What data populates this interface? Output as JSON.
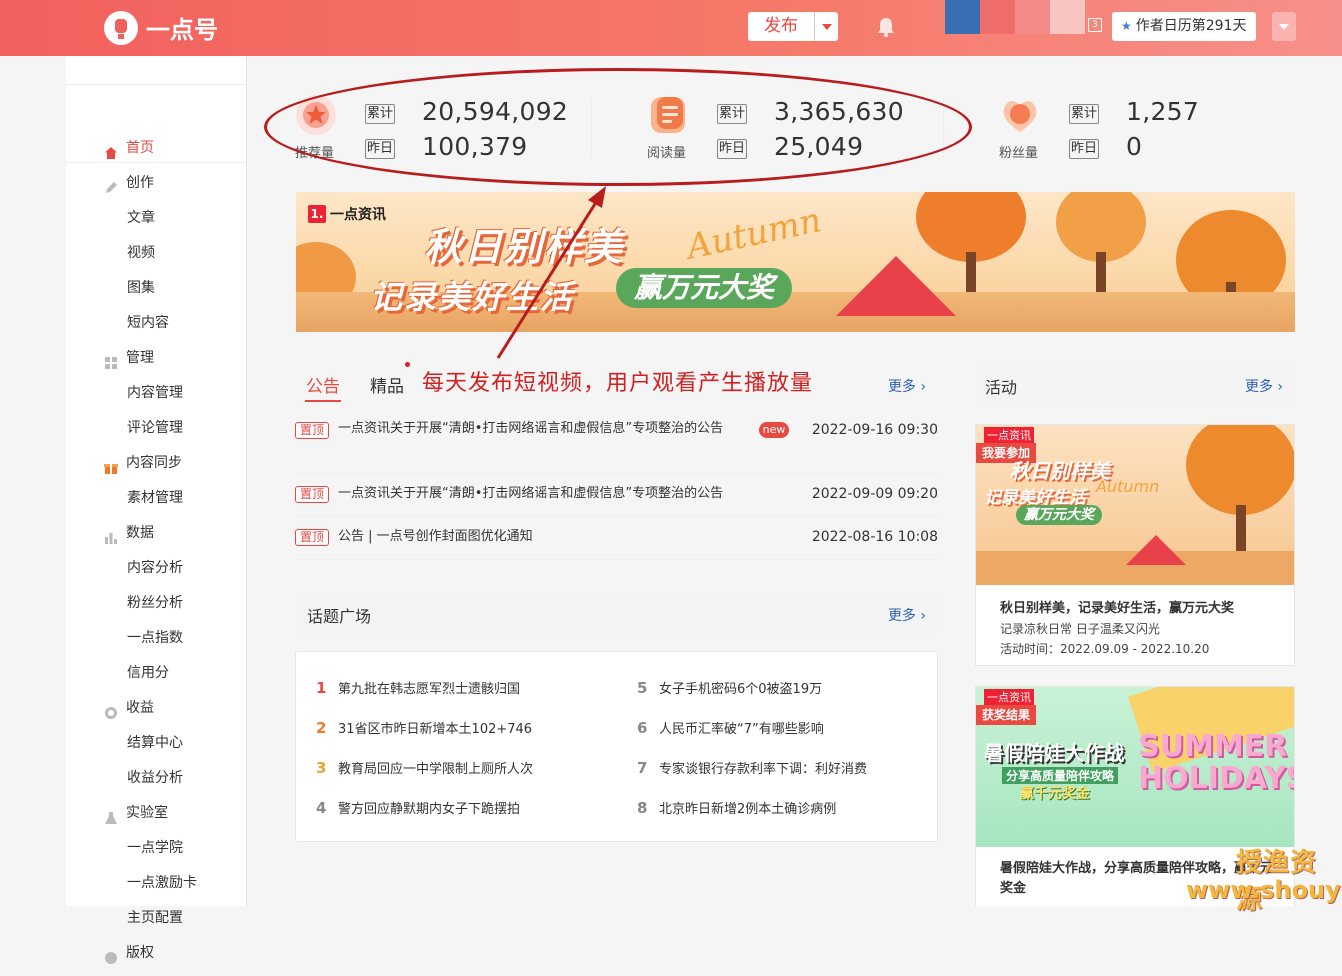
{
  "header": {
    "logo_text": "一点号",
    "publish_label": "发布",
    "notification_count": "3",
    "calendar_label": "作者日历第291天",
    "brand_color": "#f2605d"
  },
  "sidebar": {
    "items": [
      {
        "label": "首页",
        "icon": "home-icon",
        "level": 1,
        "active": true
      },
      {
        "label": "创作",
        "icon": "pen-icon",
        "level": 1
      },
      {
        "label": "文章",
        "level": 2
      },
      {
        "label": "视频",
        "level": 2
      },
      {
        "label": "图集",
        "level": 2
      },
      {
        "label": "短内容",
        "level": 2
      },
      {
        "label": "管理",
        "icon": "grid-icon",
        "level": 1
      },
      {
        "label": "内容管理",
        "level": 2
      },
      {
        "label": "评论管理",
        "level": 2
      },
      {
        "label": "内容同步",
        "icon": "gift-icon",
        "level": 1
      },
      {
        "label": "素材管理",
        "level": 2
      },
      {
        "label": "数据",
        "icon": "bar-chart-icon",
        "level": 1
      },
      {
        "label": "内容分析",
        "level": 2
      },
      {
        "label": "粉丝分析",
        "level": 2
      },
      {
        "label": "一点指数",
        "level": 2
      },
      {
        "label": "信用分",
        "level": 2
      },
      {
        "label": "收益",
        "icon": "coin-icon",
        "level": 1
      },
      {
        "label": "结算中心",
        "level": 2
      },
      {
        "label": "收益分析",
        "level": 2
      },
      {
        "label": "实验室",
        "icon": "flask-icon",
        "level": 1
      },
      {
        "label": "一点学院",
        "level": 2
      },
      {
        "label": "一点激励卡",
        "level": 2
      },
      {
        "label": "主页配置",
        "level": 2
      },
      {
        "label": "版权",
        "icon": "copyright-icon",
        "level": 1
      }
    ]
  },
  "stats": [
    {
      "label": "推荐量",
      "icon": "recommend-icon",
      "total_tag": "累计",
      "total": "20,594,092",
      "yesterday_tag": "昨日",
      "yesterday": "100,379"
    },
    {
      "label": "阅读量",
      "icon": "read-icon",
      "total_tag": "累计",
      "total": "3,365,630",
      "yesterday_tag": "昨日",
      "yesterday": "25,049"
    },
    {
      "label": "粉丝量",
      "icon": "fans-icon",
      "total_tag": "累计",
      "total": "1,257",
      "yesterday_tag": "昨日",
      "yesterday": "0"
    }
  ],
  "banner": {
    "brand": "一点资讯",
    "brand_mark": "1.",
    "title_line1": "秋日别样美",
    "title_line2": "记录美好生活",
    "prize": "赢万元大奖",
    "script_word": "Autumn"
  },
  "annotation": "每天发布短视频，用户观看产生播放量",
  "notice": {
    "tabs": [
      "公告",
      "精品"
    ],
    "more": "更多",
    "pin_label": "置顶",
    "new_label": "new",
    "rows": [
      {
        "text": "一点资讯关于开展“清朗•打击网络谣言和虚假信息”专项整治的公告",
        "date": "2022-09-16 09:30"
      },
      {
        "text": "一点资讯关于开展“清朗•打击网络谣言和虚假信息”专项整治的公告",
        "date": "2022-09-09 09:20"
      },
      {
        "text": "公告 | 一点号创作封面图优化通知",
        "date": "2022-08-16 10:08"
      }
    ]
  },
  "topics": {
    "title": "话题广场",
    "more": "更多",
    "items": [
      {
        "rank": "1",
        "text": "第九批在韩志愿军烈士遗骸归国"
      },
      {
        "rank": "2",
        "text": "31省区市昨日新增本土102+746"
      },
      {
        "rank": "3",
        "text": "教育局回应一中学限制上厕所人次"
      },
      {
        "rank": "4",
        "text": "警方回应静默期内女子下跪摆拍"
      },
      {
        "rank": "5",
        "text": "女子手机密码6个0被盗19万"
      },
      {
        "rank": "6",
        "text": "人民币汇率破“7”有哪些影响"
      },
      {
        "rank": "7",
        "text": "专家谈银行存款利率下调：利好消费"
      },
      {
        "rank": "8",
        "text": "北京昨日新增2例本土确诊病例"
      }
    ],
    "rank_colors": [
      "#e84a42",
      "#f07a2a",
      "#f0a030",
      "#888888"
    ]
  },
  "activity": {
    "title": "活动",
    "more": "更多",
    "cards": [
      {
        "tag": "我要参加",
        "brand": "一点资讯",
        "img_title1": "秋日别样美",
        "img_title2": "记录美好生活",
        "img_prize": "赢万元大奖",
        "img_script": "Autumn",
        "title": "秋日别样美，记录美好生活，赢万元大奖",
        "desc": "记录凉秋日常 日子温柔又闪光",
        "time": "活动时间：2022.09.09 - 2022.10.20"
      },
      {
        "tag": "获奖结果",
        "brand": "一点资讯",
        "img_title1": "暑假陪娃大作战",
        "img_title2": "分享高质量陪伴攻略",
        "img_prize": "赢千元奖金",
        "img_script": "SUMMER HOLIDAYS",
        "title": "暑假陪娃大作战，分享高质量陪伴攻略，赢千元奖金"
      }
    ]
  },
  "watermark": {
    "line1": "授渔资源",
    "line2": "www.shouyu.pw"
  }
}
